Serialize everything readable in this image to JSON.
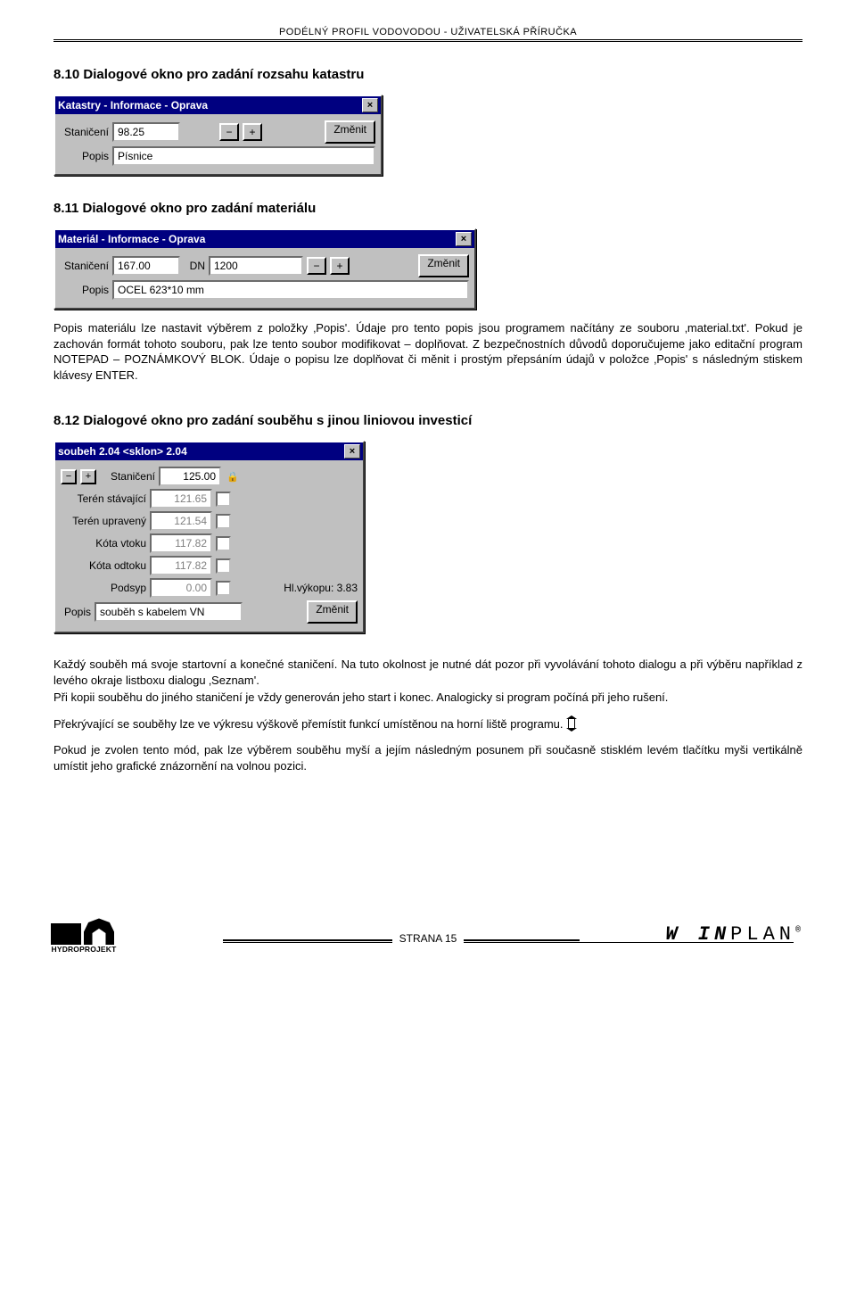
{
  "header": "PODÉLNÝ PROFIL VODOVODOU  -  UŽIVATELSKÁ PŘÍRUČKA",
  "s810": {
    "title": "8.10 Dialogové okno pro zadání rozsahu katastru",
    "dlg": {
      "title": "Katastry - Informace - Oprava",
      "stan_label": "Staničení",
      "stan_value": "98.25",
      "popis_label": "Popis",
      "popis_value": "Písnice",
      "btn_minus": "−",
      "btn_plus": "+",
      "btn_change": "Změnit"
    }
  },
  "s811": {
    "title": "8.11 Dialogové okno pro zadání materiálu",
    "dlg": {
      "title": "Materiál - Informace - Oprava",
      "stan_label": "Staničení",
      "stan_value": "167.00",
      "dn_label": "DN",
      "dn_value": "1200",
      "popis_label": "Popis",
      "popis_value": "OCEL 623*10 mm",
      "btn_minus": "−",
      "btn_plus": "+",
      "btn_change": "Změnit"
    },
    "para": "Popis materiálu lze nastavit výběrem z položky ‚Popis'. Údaje pro tento popis jsou programem načítány ze souboru ‚material.txt'. Pokud je zachován formát  tohoto souboru, pak lze tento soubor modifikovat – doplňovat. Z bezpečnostních důvodů doporučujeme jako editační program NOTEPAD – POZNÁMKOVÝ BLOK. Údaje o popisu lze doplňovat či měnit i prostým přepsáním údajů v položce ‚Popis' s následným stiskem klávesy ENTER."
  },
  "s812": {
    "title": "8.12 Dialogové okno pro zadání souběhu s jinou liniovou investicí",
    "dlg": {
      "title": "soubeh  2.04 <sklon>  2.04",
      "btn_minus": "−",
      "btn_plus": "+",
      "rows": {
        "stan": {
          "label": "Staničení",
          "value": "125.00",
          "grey": false
        },
        "ts": {
          "label": "Terén stávající",
          "value": "121.65",
          "grey": true
        },
        "tu": {
          "label": "Terén upravený",
          "value": "121.54",
          "grey": true
        },
        "kv": {
          "label": "Kóta vtoku",
          "value": "117.82",
          "grey": true
        },
        "ko": {
          "label": "Kóta odtoku",
          "value": "117.82",
          "grey": true
        },
        "pod": {
          "label": "Podsyp",
          "value": "0.00",
          "grey": true
        }
      },
      "hlvykopu_label": "Hl.výkopu:",
      "hlvykopu_value": "3.83",
      "popis_label": "Popis",
      "popis_value": "souběh s kabelem VN",
      "btn_change": "Změnit"
    },
    "para1": "Každý souběh má svoje startovní a konečné staničení. Na tuto okolnost je nutné dát pozor při vyvolávání tohoto dialogu a při výběru například z levého okraje listboxu dialogu ‚Seznam'.",
    "para2": "Při kopii souběhu do jiného staničení je vždy generován jeho start i konec. Analogicky si program počíná při jeho rušení.",
    "para3": "Překrývající se souběhy lze ve výkresu výškově přemístit funkcí umístěnou na horní liště programu.",
    "para4": "Pokud je zvolen tento mód, pak lze výběrem souběhu myší a jejím následným posunem při současně stisklém levém tlačítku myši vertikálně umístit jeho grafické znázornění na volnou pozici."
  },
  "footer": {
    "page": "STRANA 15",
    "brand_bold": "W IN",
    "brand_rest": "PLAN",
    "logo_text": "HYDROPROJEKT"
  }
}
